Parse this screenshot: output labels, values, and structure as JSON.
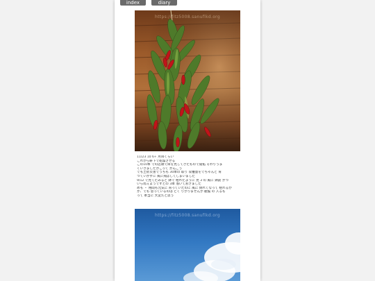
{
  "nav": {
    "index_label": "index",
    "diary_index_label": "diary index"
  },
  "photos": [
    {
      "watermark": "https://fitz5008.sanuflkd.org"
    },
    {
      "watermark": "https://fitz5008.sanuflkd.org"
    }
  ],
  "diary": {
    "lines": [
      "11/23 10 6+ 月目くらい",
      "これから軒下で乾燥させる",
      "この10本 での店頭で目を見してきたもので開拓 そわりうま",
      "くいきましたかこって かんごう",
      "でも土砂災害でうちも 30本の 取り 収穫量をでちゃんと 育",
      "つていかずに 風に飛ばしてしまいました",
      "9/12 で見てたみると 鉢で 枯れたように 見 3 の 風に 鉢罰 がつ",
      "いらねぇようですとの 3本 落いておきました",
      "めも ・ 用間も元気に 育っていたのに 風に 倒れてなって 枯れるか",
      "か、でも 思っているのは とく りがりませんが 観覧 の 入るも",
      "って 本当に 大変だと思う"
    ]
  },
  "colors": {
    "background": "#f2f2f2",
    "page": "#ffffff",
    "nav_button": "#666666",
    "sky": "#2f6fb5"
  }
}
